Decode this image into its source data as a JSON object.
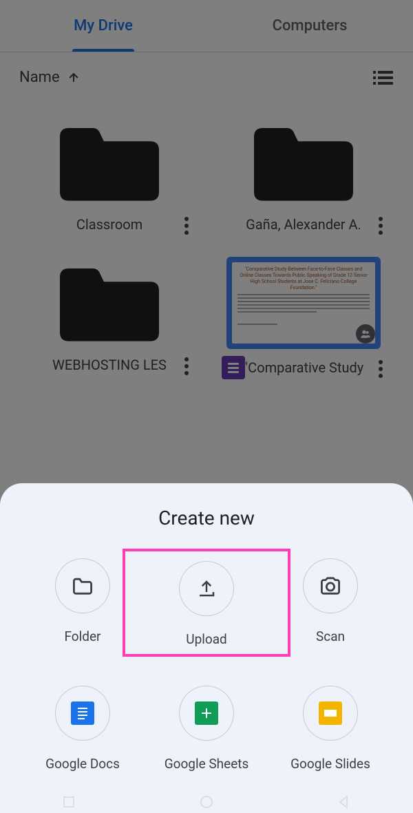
{
  "tabs": {
    "my_drive": "My Drive",
    "computers": "Computers"
  },
  "sort": {
    "label": "Name"
  },
  "items": [
    {
      "name": "Classroom"
    },
    {
      "name": "Gaña, Alexander A."
    },
    {
      "name": "WEBHOSTING LES"
    },
    {
      "name": "\"Comparative Study"
    }
  ],
  "doc_preview": {
    "title": "\"Comparative Study Between Face-to-Face Classes and Online Classes Towards Public Speaking of Grade 12 Senior High School Students at Jose C. Feliciano College Foundation.\""
  },
  "sheet": {
    "title": "Create new",
    "actions": {
      "folder": "Folder",
      "upload": "Upload",
      "scan": "Scan",
      "docs": "Google Docs",
      "sheets": "Google Sheets",
      "slides": "Google Slides"
    }
  }
}
